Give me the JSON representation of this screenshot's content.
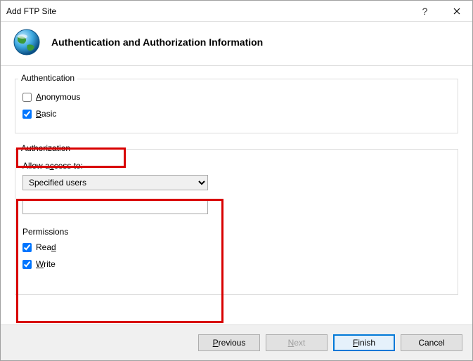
{
  "window": {
    "title": "Add FTP Site"
  },
  "header": {
    "title": "Authentication and Authorization Information"
  },
  "auth": {
    "legend": "Authentication",
    "anonymous_label": "Anonymous",
    "anonymous_checked": false,
    "basic_label": "Basic",
    "basic_checked": true
  },
  "authorization": {
    "legend": "Authorization",
    "allow_label": "Allow access to:",
    "combo_value": "Specified users",
    "textbox_value": "",
    "permissions_label": "Permissions",
    "read_label": "Read",
    "read_checked": true,
    "write_label": "Write",
    "write_checked": true
  },
  "footer": {
    "previous": "Previous",
    "next": "Next",
    "finish": "Finish",
    "cancel": "Cancel"
  }
}
